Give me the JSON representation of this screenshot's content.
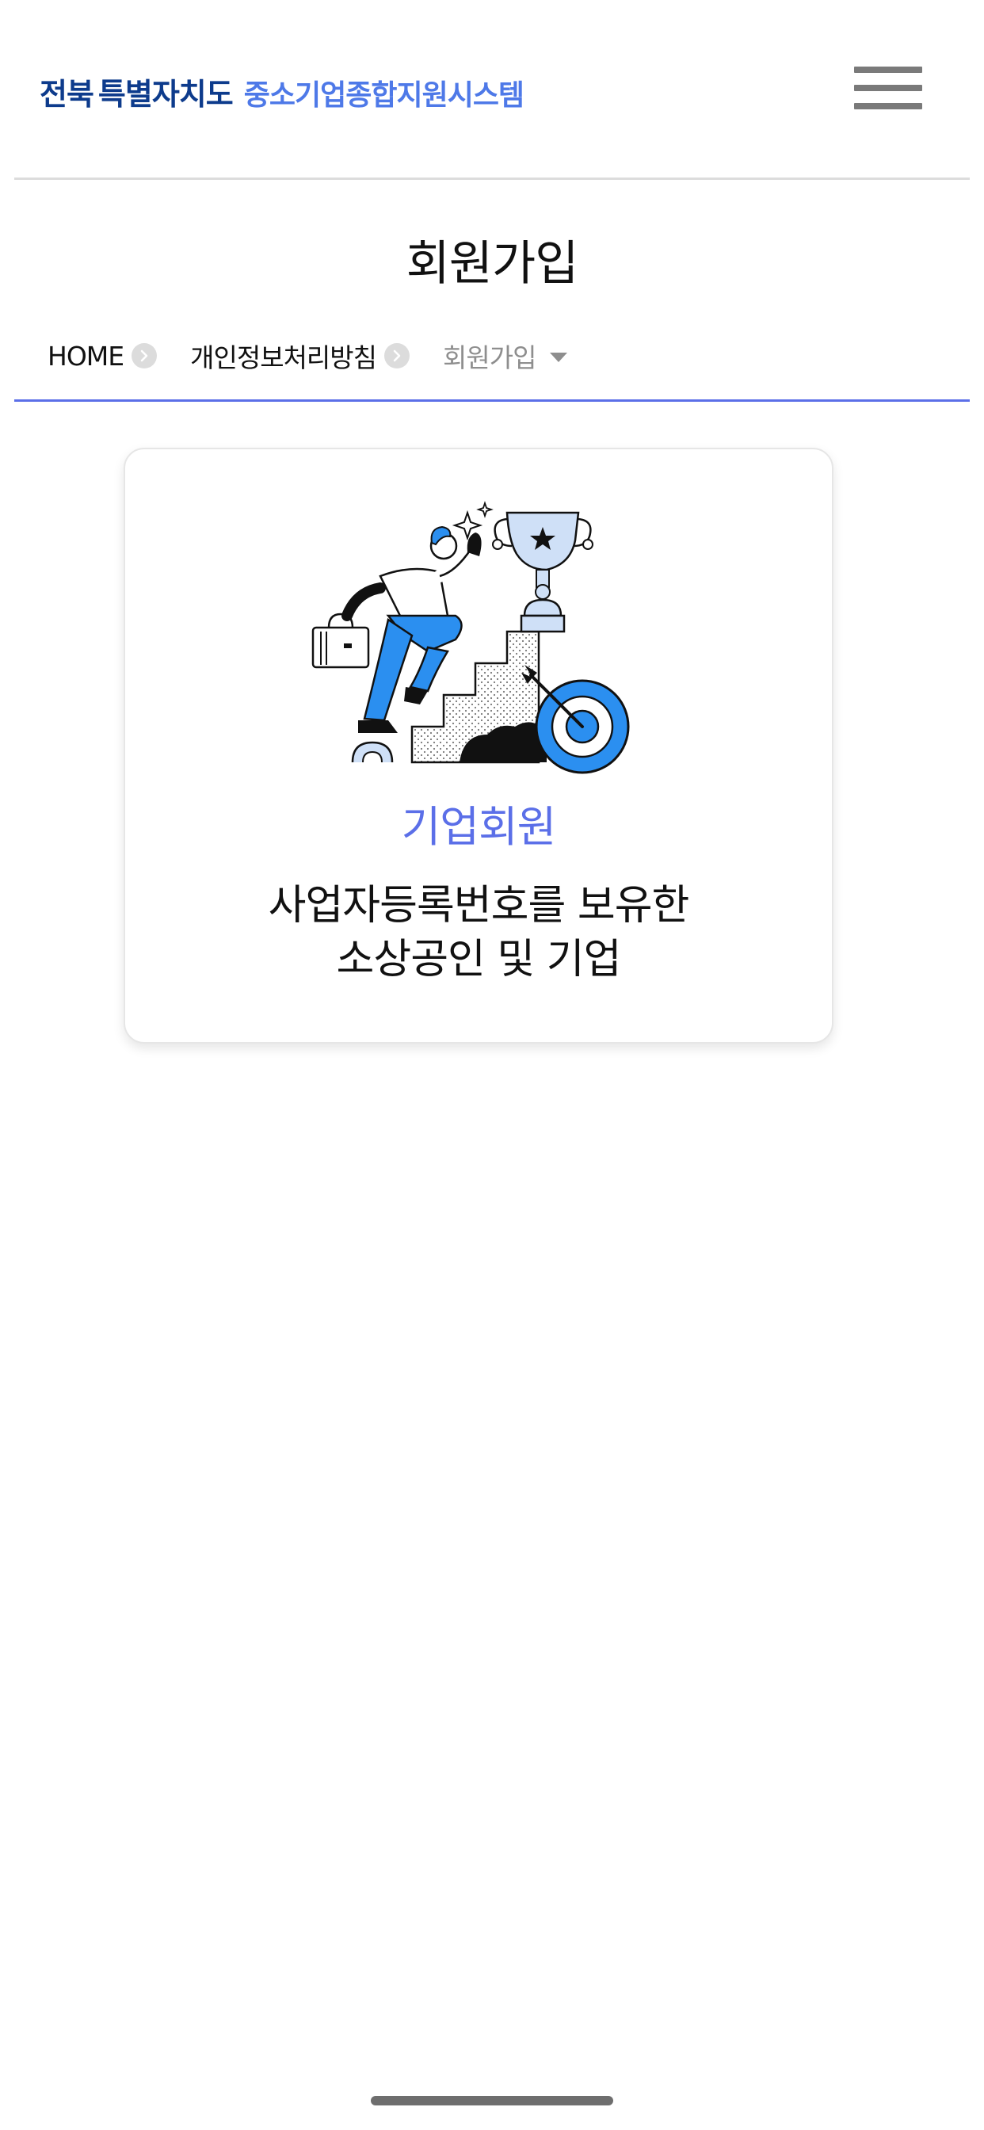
{
  "header": {
    "logo_region": "전북",
    "logo_special": "특별자치도",
    "logo_system": "중소기업종합지원시스템",
    "menu_icon": "hamburger-icon"
  },
  "page": {
    "title": "회원가입"
  },
  "breadcrumb": {
    "items": [
      "HOME",
      "개인정보처리방침",
      "회원가입"
    ],
    "separator_icon": "chevron-right-icon",
    "dropdown_icon": "caret-down-icon"
  },
  "member_card": {
    "title": "기업회원",
    "desc_line1": "사업자등록번호를 보유한",
    "desc_line2": "소상공인 및 기업",
    "illustration": "business-climb-trophy-target-illustration"
  },
  "colors": {
    "brand_dark": "#0d3b8c",
    "brand_accent": "#4e79e8",
    "accent_line": "#5b6fe8",
    "illustration_blue": "#2b8ff0",
    "illustration_light_blue": "#cfe0f7"
  }
}
